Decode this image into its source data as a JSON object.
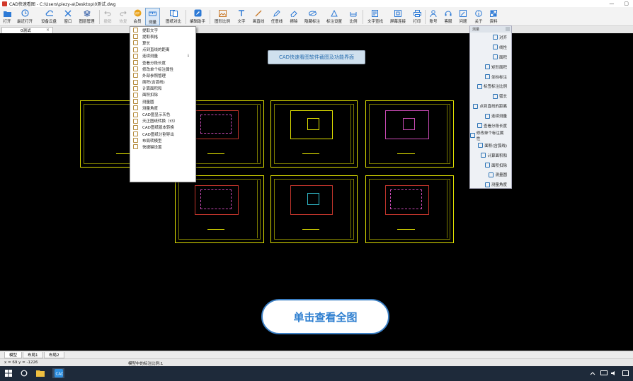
{
  "window": {
    "title": "CAD快速看图 - C:\\Users\\piezy-a\\Desktop\\0测试.dwg",
    "controls": [
      "—",
      "▢"
    ]
  },
  "toolbar": [
    {
      "id": "open",
      "label": "打开",
      "icon": "folder-icon",
      "disabled": false
    },
    {
      "id": "recent",
      "label": "最近打开",
      "icon": "clock-icon",
      "disabled": false
    },
    {
      "id": "cloud",
      "label": "设备云盘",
      "icon": "cloud-icon",
      "disabled": false
    },
    {
      "id": "window",
      "label": "窗口",
      "icon": "window-icon",
      "disabled": false
    },
    {
      "id": "layers",
      "label": "图层管理",
      "icon": "layers-icon",
      "disabled": false
    },
    {
      "id": "undo",
      "label": "撤销",
      "icon": "undo-icon",
      "disabled": true
    },
    {
      "id": "redo",
      "label": "恢复",
      "icon": "redo-icon",
      "disabled": true
    },
    {
      "id": "vip",
      "label": "会员",
      "icon": "vip-icon",
      "disabled": false
    },
    {
      "id": "measure",
      "label": "测量",
      "icon": "ruler-icon",
      "disabled": false,
      "active": true
    },
    {
      "id": "compare",
      "label": "图纸对比",
      "icon": "compare-icon",
      "disabled": false
    },
    {
      "id": "edit",
      "label": "编辑助手",
      "icon": "edit-icon",
      "disabled": false
    },
    {
      "id": "ratio",
      "label": "图形比例",
      "icon": "image-icon",
      "disabled": false
    },
    {
      "id": "text",
      "label": "文字",
      "icon": "text-icon",
      "disabled": false
    },
    {
      "id": "line",
      "label": "画直线",
      "icon": "line-icon",
      "disabled": false
    },
    {
      "id": "freehand",
      "label": "任意线",
      "icon": "pencil-icon",
      "disabled": false
    },
    {
      "id": "erase",
      "label": "擦除",
      "icon": "eraser-icon",
      "disabled": false
    },
    {
      "id": "hide",
      "label": "隐藏标注",
      "icon": "eye-off-icon",
      "disabled": false
    },
    {
      "id": "annotset",
      "label": "标注设置",
      "icon": "annotation-icon",
      "disabled": false
    },
    {
      "id": "scale",
      "label": "比例",
      "icon": "scale-icon",
      "disabled": false
    },
    {
      "id": "findtext",
      "label": "文字查找",
      "icon": "find-text-icon",
      "disabled": false
    },
    {
      "id": "screenshot",
      "label": "屏幕连接",
      "icon": "screenshot-icon",
      "disabled": false
    },
    {
      "id": "print",
      "label": "打印",
      "icon": "print-icon",
      "disabled": false
    },
    {
      "id": "account",
      "label": "账号",
      "icon": "user-icon",
      "disabled": false
    },
    {
      "id": "service",
      "label": "客服",
      "icon": "headset-icon",
      "disabled": false
    },
    {
      "id": "feedback",
      "label": "问题",
      "icon": "feedback-icon",
      "disabled": false
    },
    {
      "id": "about",
      "label": "关于",
      "icon": "info-icon",
      "disabled": false
    },
    {
      "id": "resources",
      "label": "资料",
      "icon": "resources-icon",
      "disabled": false
    }
  ],
  "doc_tab": {
    "label": "0测试",
    "close": "×"
  },
  "canvas": {
    "banner": "CAD快速看图软件截图及功能界面",
    "view_all_button": "单击查看全图"
  },
  "measure_menu": [
    {
      "label": "提取文字",
      "icon": "extract-text-icon"
    },
    {
      "label": "提取表格",
      "icon": "extract-table-icon"
    },
    {
      "label": "算长",
      "icon": "length-icon"
    },
    {
      "label": "点到直线的距离",
      "icon": "point-line-icon"
    },
    {
      "label": "连续测量",
      "icon": "continuous-icon",
      "submenu": "↓"
    },
    {
      "label": "查看分段长度",
      "icon": "segment-icon"
    },
    {
      "label": "修改单个标注属性",
      "icon": "edit-annotation-icon"
    },
    {
      "label": "外部参照管理",
      "icon": "xref-icon"
    },
    {
      "label": "面积(含弧线)",
      "icon": "area-arc-icon"
    },
    {
      "label": "计算面积和",
      "icon": "area-sum-icon"
    },
    {
      "label": "面积扣除",
      "icon": "area-subtract-icon"
    },
    {
      "label": "测量圆",
      "icon": "circle-icon"
    },
    {
      "label": "测量角度",
      "icon": "angle-icon"
    },
    {
      "label": "CAD图显示灰色",
      "icon": "gray-icon"
    },
    {
      "label": "天正图纸转换（t3）",
      "icon": "convert-icon"
    },
    {
      "label": "CAD图纸版本转换",
      "icon": "version-icon"
    },
    {
      "label": "CAD图纸分割导出",
      "icon": "split-icon"
    },
    {
      "label": "布局转模型",
      "icon": "layout-icon"
    },
    {
      "label": "快捷键设置",
      "icon": "keyboard-icon"
    }
  ],
  "measure_panel": {
    "title": "测量",
    "items": [
      "对齐",
      "线性",
      "面积",
      "矩形面积",
      "坐标标注",
      "标签标注比例",
      "弧长",
      "点到直线的距离",
      "连续测量",
      "查看分段长度",
      "修改单个标注属性",
      "面积(含弧线)",
      "计算面积和",
      "面积扣除",
      "测量圆",
      "测量角度"
    ]
  },
  "layout_tabs": [
    "模型",
    "布局1",
    "布局2"
  ],
  "status": {
    "coord": "x = 69  y = -1226",
    "scale": "模型中的标注比例:1"
  },
  "colors": {
    "accent": "#2f7fd0",
    "frame": "#e0e000",
    "red": "#c0342b",
    "magenta": "#c84ab4",
    "cyan": "#2fb7c7"
  }
}
